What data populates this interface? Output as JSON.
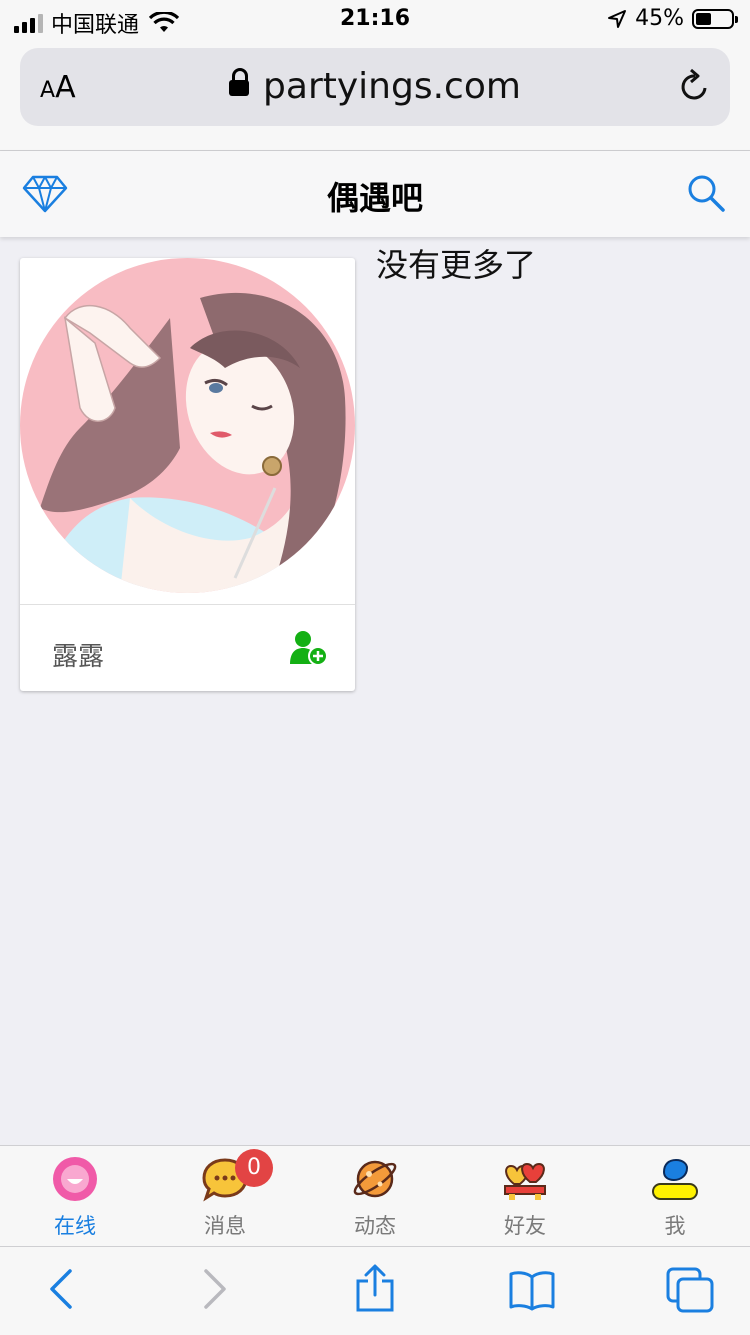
{
  "status_bar": {
    "carrier": "中国联通",
    "time": "21:16",
    "battery_percent": "45%",
    "battery_level": 0.45,
    "icons": [
      "signal-icon",
      "wifi-icon",
      "location-arrow-icon",
      "battery-icon"
    ]
  },
  "browser": {
    "text_size_label_small": "A",
    "text_size_label_large": "A",
    "url": "partyings.com",
    "icons": [
      "lock-icon",
      "reload-icon"
    ]
  },
  "header": {
    "title": "偶遇吧",
    "icons": [
      "diamond-icon",
      "search-icon"
    ],
    "accent_color": "#1a7fe0"
  },
  "main": {
    "end_message": "没有更多了",
    "cards": [
      {
        "name": "露露",
        "avatar": "woman-portrait-illustration",
        "action_icon": "add-friend-icon"
      }
    ]
  },
  "tabs": [
    {
      "label": "在线",
      "icon": "online-icon",
      "active": true
    },
    {
      "label": "消息",
      "icon": "message-icon",
      "badge": "0"
    },
    {
      "label": "动态",
      "icon": "planet-icon"
    },
    {
      "label": "好友",
      "icon": "friends-icon"
    },
    {
      "label": "我",
      "icon": "profile-icon"
    }
  ],
  "safari_toolbar": {
    "icons": [
      "back-icon",
      "forward-icon",
      "share-icon",
      "bookmarks-icon",
      "tabs-icon"
    ]
  },
  "colors": {
    "accent": "#1a7fe0",
    "add_icon_green": "#14b014",
    "badge_red": "#e24444",
    "background": "#efeff4"
  }
}
